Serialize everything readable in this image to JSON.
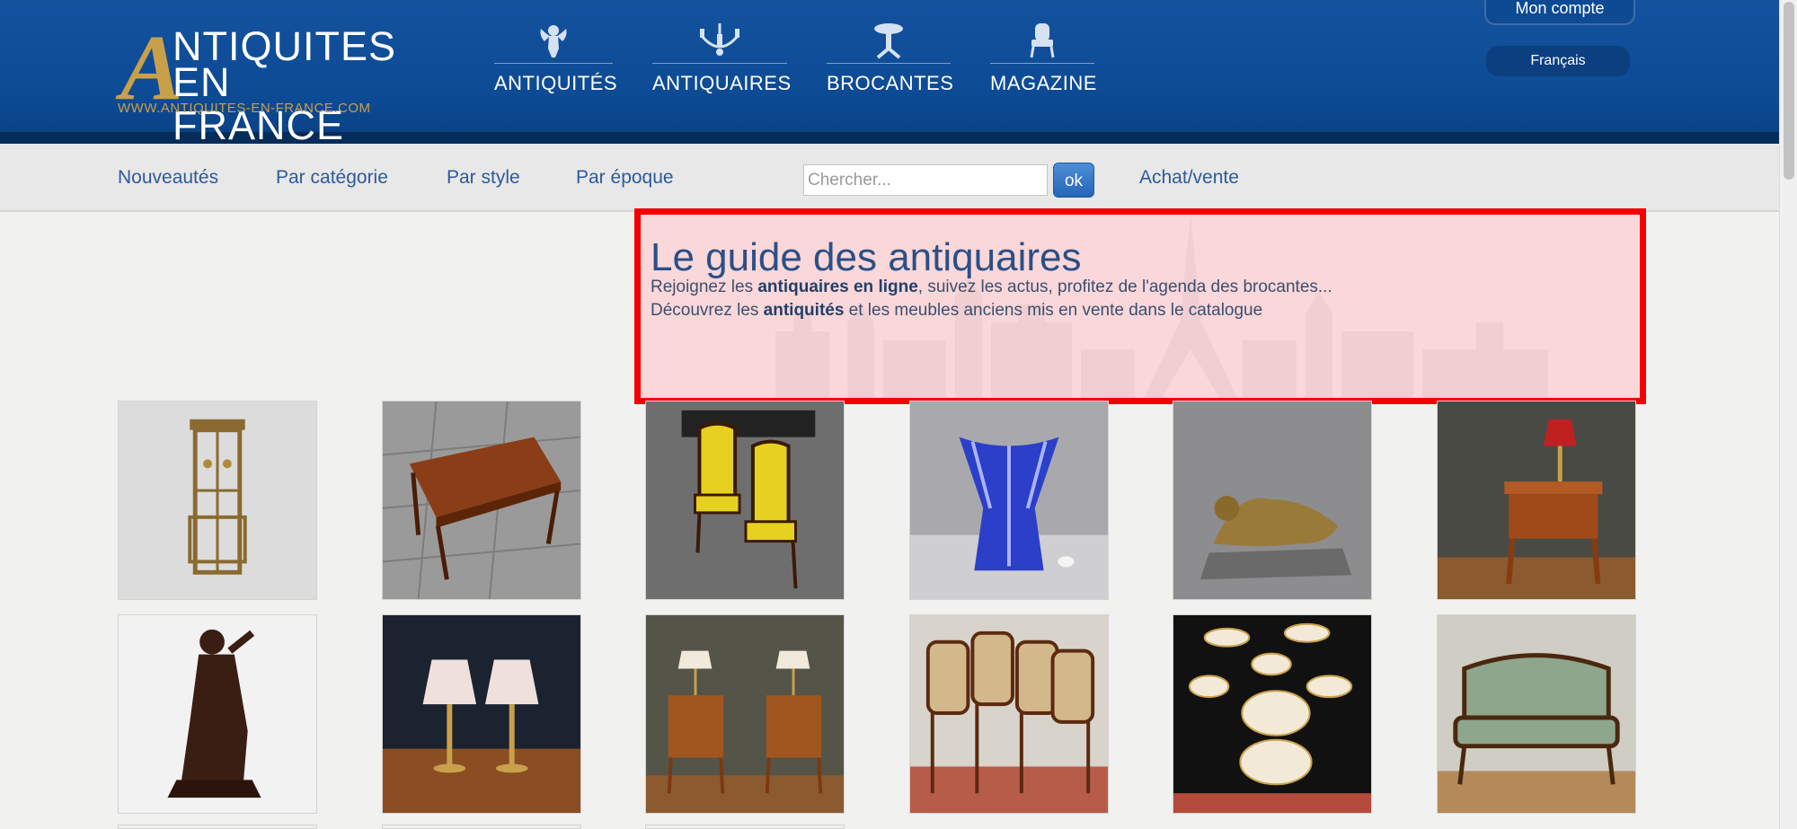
{
  "brand": {
    "logo_big_letter": "A",
    "logo_line1": "NTIQUITES",
    "logo_line2": "EN FRANCE",
    "logo_url": "WWW.ANTIQUITES-EN-FRANCE.COM"
  },
  "main_nav": [
    {
      "label": "ANTIQUITÉS",
      "icon": "cherub-icon"
    },
    {
      "label": "ANTIQUAIRES",
      "icon": "chandelier-icon"
    },
    {
      "label": "BROCANTES",
      "icon": "gueridon-table-icon"
    },
    {
      "label": "MAGAZINE",
      "icon": "armchair-icon"
    }
  ],
  "account": {
    "label": "Mon compte"
  },
  "language": {
    "label": "Français"
  },
  "sub_nav": {
    "items": [
      "Nouveautés",
      "Par catégorie",
      "Par style",
      "Par époque"
    ],
    "search_placeholder": "Chercher...",
    "ok_label": "ok",
    "achat_label": "Achat/vente"
  },
  "hero": {
    "title": "Le guide des antiquaires",
    "line1_pre": "Rejoignez les ",
    "line1_bold": "antiquaires en ligne",
    "line1_post": ", suivez les actus, profitez de l'agenda des brocantes...",
    "line2_pre": "Découvrez les ",
    "line2_bold": "antiquités",
    "line2_post": " et les meubles anciens mis en vente dans le catalogue"
  },
  "products": [
    {
      "name": "coat-rack-image"
    },
    {
      "name": "writing-table-image"
    },
    {
      "name": "yellow-chairs-image"
    },
    {
      "name": "blue-crystal-vase-image"
    },
    {
      "name": "bronze-panther-image"
    },
    {
      "name": "bedside-table-lamp-image"
    },
    {
      "name": "bronze-statue-image"
    },
    {
      "name": "pair-of-lamps-image"
    },
    {
      "name": "pair-of-nightstands-image"
    },
    {
      "name": "cane-chairs-image"
    },
    {
      "name": "porcelain-plates-image"
    },
    {
      "name": "louis-xv-settee-image"
    }
  ],
  "colors": {
    "header_blue": "#0c4a94",
    "gold": "#c9a04a",
    "link_blue": "#2d5a9b",
    "highlight_red": "#f40000"
  }
}
